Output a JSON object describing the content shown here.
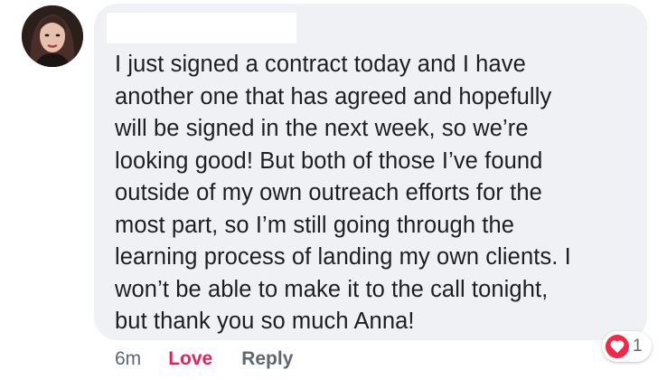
{
  "comment": {
    "body": "I just signed a contract today and I have\nanother one that has agreed and hopefully\nwill be signed in the next week, so we’re\nlooking good! But both of those I’ve found\noutside of my own outreach efforts for the\nmost part, so I’m still going through the\nlearning process of landing my own clients. I\nwon’t be able to make it to the call tonight,\nbut thank you so much Anna!",
    "timestamp": "6m",
    "love_label": "Love",
    "reply_label": "Reply",
    "reaction_count": "1",
    "reaction_icon": "heart-icon"
  },
  "colors": {
    "bubble": "#f0f1f4",
    "love": "#e0245e",
    "heart": "#f0284a",
    "meta": "#606770",
    "text": "#1c1e21"
  }
}
